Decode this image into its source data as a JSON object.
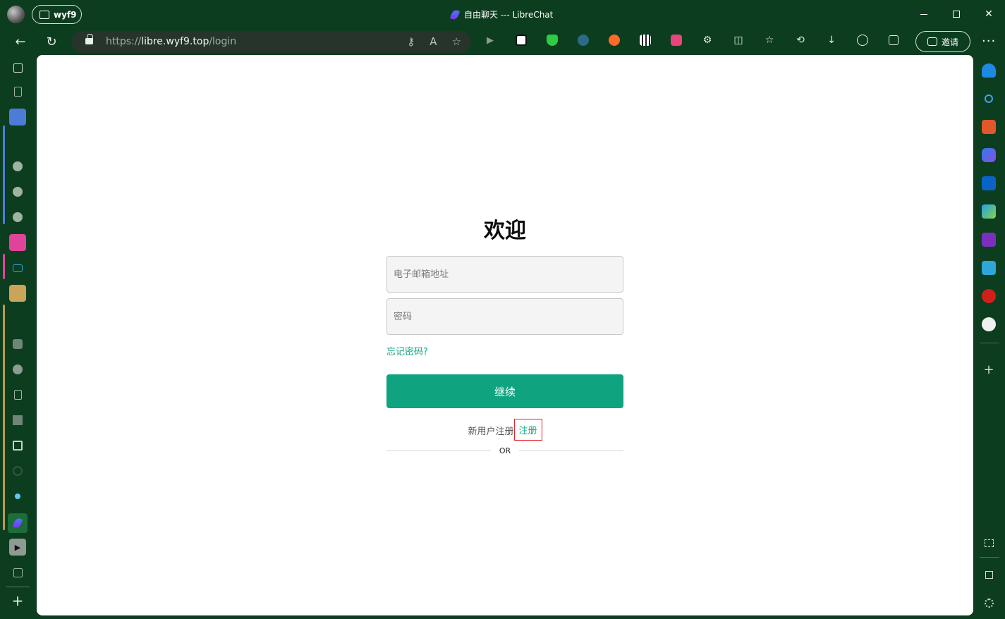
{
  "window": {
    "profile_name": "wyf9",
    "tab_title": "自由聊天 --- LibreChat",
    "controls": {
      "minimize": "minimize",
      "maximize": "maximize",
      "close": "✕"
    }
  },
  "address_bar": {
    "url_prefix": "https://",
    "url_host": "libre.wyf9.top",
    "url_path": "/login",
    "invite_label": "邀请",
    "more_label": "···"
  },
  "icons": {
    "back": "←",
    "refresh": "↻",
    "key": "⚷",
    "read_aloud": "A",
    "favorite": "☆",
    "extensions": "⚙",
    "split": "◫",
    "favorites": "☆",
    "history": "⟲",
    "downloads": "↓",
    "add": "+"
  },
  "colors": {
    "chrome_bg": "#0c3d1f",
    "accent": "#10a37f",
    "highlight_box": "#e0242a"
  },
  "login": {
    "heading": "欢迎",
    "email_placeholder": "电子邮箱地址",
    "password_placeholder": "密码",
    "forgot_password": "忘记密码?",
    "continue_button": "继续",
    "signup_prompt": "新用户注册",
    "signup_link": "注册",
    "divider_text": "OR"
  }
}
